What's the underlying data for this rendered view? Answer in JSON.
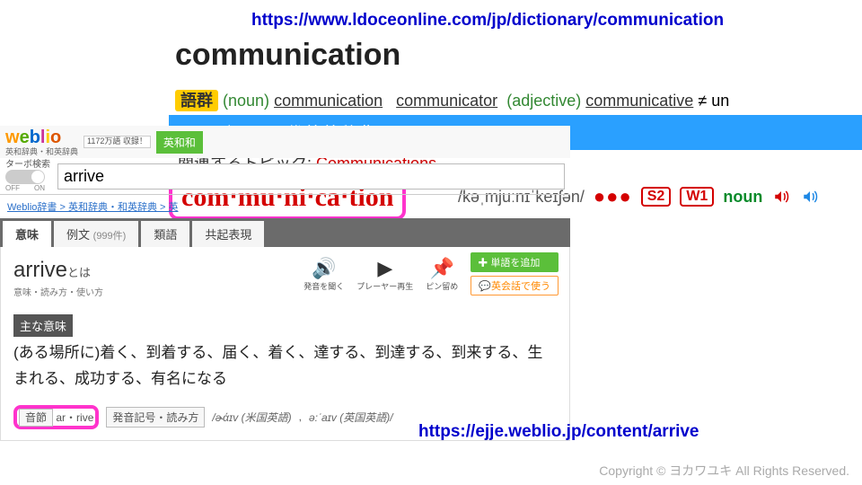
{
  "urls": {
    "top": "https://www.ldoceonline.com/jp/dictionary/communication",
    "bottom": "https://ejje.weblio.jp/content/arrive"
  },
  "ldoce": {
    "headword": "communication",
    "family_tag": "語群",
    "pos_noun": "(noun)",
    "pos_adj": "(adjective)",
    "wf1": "communication",
    "wf2": "communicator",
    "wf3": "communicative",
    "neq": "≠ un",
    "blue_bar": "ロングマン現代英英辞典より",
    "topics_label": "関連するトピック:",
    "topics_link": "Communications",
    "syllables": "com‧mu‧ni‧ca‧tion",
    "ipa": "/kəˌmjuːnɪˈkeɪʃən/",
    "dots": "●●●",
    "s2": "S2",
    "w1": "W1",
    "noun": "noun"
  },
  "weblio": {
    "sub": "英和辞典・和英辞典",
    "badge": "1172万語\n収録！",
    "green": "英和和",
    "turbo": "ターボ検索",
    "off": "OFF",
    "on": "ON",
    "search_value": "arrive",
    "crumb": "Weblio辞書 > 英和辞典・和英辞典 > 英",
    "tabs": {
      "t1": "意味",
      "t2": "例文",
      "t2_count": "(999件)",
      "t3": "類語",
      "t4": "共起表現"
    },
    "entry": {
      "word": "arrive",
      "toha": "とは",
      "sub": "意味・読み方・使い方",
      "tool_listen": "発音を聞く",
      "tool_play": "プレーヤー再生",
      "tool_pin": "ピン留め",
      "btn_add": "単語を追加",
      "btn_eikaiwa": "英会話で使う",
      "mean_label": "主な意味",
      "mean_text": "(ある場所に)着く、到着する、届く、着く、達する、到達する、到来する、生まれる、成功する、有名になる",
      "foot_syll_label": "音節",
      "foot_syll": "ar・rive",
      "foot_pron_label": "発音記号・読み方",
      "foot_ipa_us": "/ɚάɪv (米国英語)",
      "foot_ipa_uk": "ə:ˈaɪv (英国英語)/"
    }
  },
  "copyright": "Copyright © ヨカワユキ All Rights Reserved."
}
